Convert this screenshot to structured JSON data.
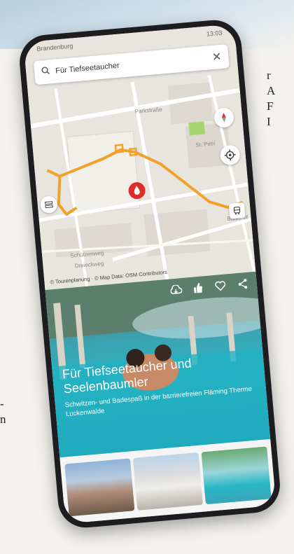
{
  "side_text": {
    "right": [
      "r",
      "A",
      "F",
      "I"
    ],
    "left": [
      "-",
      "n"
    ]
  },
  "status": {
    "left": "Brandenburg",
    "right": "13:03"
  },
  "search": {
    "query": "Für Tiefseetaucher",
    "close_icon": "close-icon"
  },
  "map": {
    "labels": {
      "street1": "Parkstraße",
      "poi": "St. Petri",
      "street2": "Schützenweg",
      "street3": "Dreieckweg",
      "street4": "Bahnhof"
    },
    "copyright": "© Tourenplanung · © Map Data: OSM Contributors"
  },
  "hero": {
    "title": "Für Tiefseetaucher und Seelenbaumler",
    "subtitle": "Schwitzen- und Badespaß in der barrierefreien Fläming Therme Luckenwalde"
  },
  "colors": {
    "route": "#f2a12a",
    "marker": "#e02b2b",
    "accent": "#2bb3c2"
  }
}
